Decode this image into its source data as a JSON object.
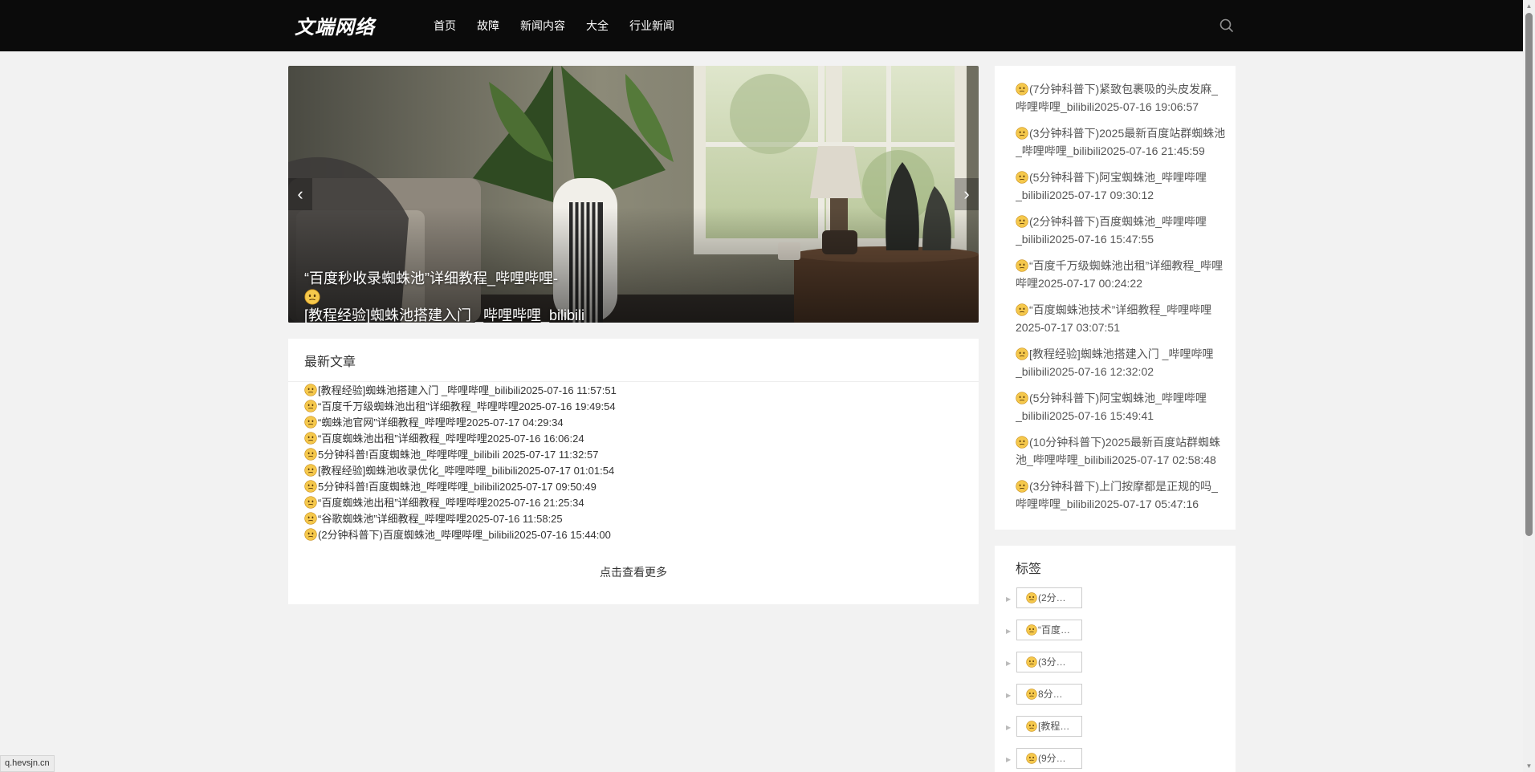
{
  "header": {
    "logo": "文端网络",
    "nav": [
      "首页",
      "故障",
      "新闻内容",
      "大全",
      "行业新闻"
    ]
  },
  "icons": {
    "search": "search-icon",
    "emoji": "confused-face-emoji"
  },
  "banner": {
    "caption": "“百度秒收录蜘蛛池”详细教程_哔哩哔哩-😶[教程经验]蜘蛛池搭建入门 _哔哩哔哩_bilibili",
    "caption_prefix": "“百度秒收录蜘蛛池”详细教程_哔哩哔哩-",
    "caption_suffix": "[教程经验]蜘蛛池搭建入门 _哔哩哔哩_bilibili",
    "prev": "‹",
    "next": "›"
  },
  "latest": {
    "title": "最新文章",
    "items": [
      "[教程经验]蜘蛛池搭建入门 _哔哩哔哩_bilibili2025-07-16 11:57:51",
      "“百度千万级蜘蛛池出租”详细教程_哔哩哔哩2025-07-16 19:49:54",
      "“蜘蛛池官网”详细教程_哔哩哔哩2025-07-17 04:29:34",
      "“百度蜘蛛池出租”详细教程_哔哩哔哩2025-07-16 16:06:24",
      "5分钟科普!百度蜘蛛池_哔哩哔哩_bilibili 2025-07-17 11:32:57",
      "[教程经验]蜘蛛池收录优化_哔哩哔哩_bilibili2025-07-17 01:01:54",
      "5分钟科普!百度蜘蛛池_哔哩哔哩_bilibili2025-07-17 09:50:49",
      "“百度蜘蛛池出租”详细教程_哔哩哔哩2025-07-16 21:25:34",
      "“谷歌蜘蛛池”详细教程_哔哩哔哩2025-07-16 11:58:25",
      "(2分钟科普下)百度蜘蛛池_哔哩哔哩_bilibili2025-07-16 15:44:00"
    ],
    "more": "点击查看更多"
  },
  "hot": {
    "items": [
      "(7分钟科普下)紧致包裹吸的头皮发麻_哔哩哔哩_bilibili2025-07-16 19:06:57",
      "(3分钟科普下)2025最新百度站群蜘蛛池_哔哩哔哩_bilibili2025-07-16 21:45:59",
      "(5分钟科普下)阿宝蜘蛛池_哔哩哔哩_bilibili2025-07-17 09:30:12",
      "(2分钟科普下)百度蜘蛛池_哔哩哔哩_bilibili2025-07-16 15:47:55",
      "“百度千万级蜘蛛池出租”详细教程_哔哩哔哩2025-07-17 00:24:22",
      "“百度蜘蛛池技术”详细教程_哔哩哔哩2025-07-17 03:07:51",
      "[教程经验]蜘蛛池搭建入门 _哔哩哔哩_bilibili2025-07-16 12:32:02",
      "(5分钟科普下)阿宝蜘蛛池_哔哩哔哩_bilibili2025-07-16 15:49:41",
      "(10分钟科普下)2025最新百度站群蜘蛛池_哔哩哔哩_bilibili2025-07-17 02:58:48",
      "(3分钟科普下)上门按摩都是正规的吗_哔哩哔哩_bilibili2025-07-17 05:47:16"
    ]
  },
  "tags": {
    "title": "标签",
    "items": [
      "(2分…",
      "“百度…",
      "(3分…",
      "8分…",
      "[教程…",
      "(9分…"
    ]
  },
  "status_url": "q.hevsjn.cn",
  "colors": {
    "header_bg": "#0b0b0b",
    "page_bg": "#f2f2f2",
    "panel_bg": "#ffffff",
    "emoji_face": "#f5c84c"
  }
}
